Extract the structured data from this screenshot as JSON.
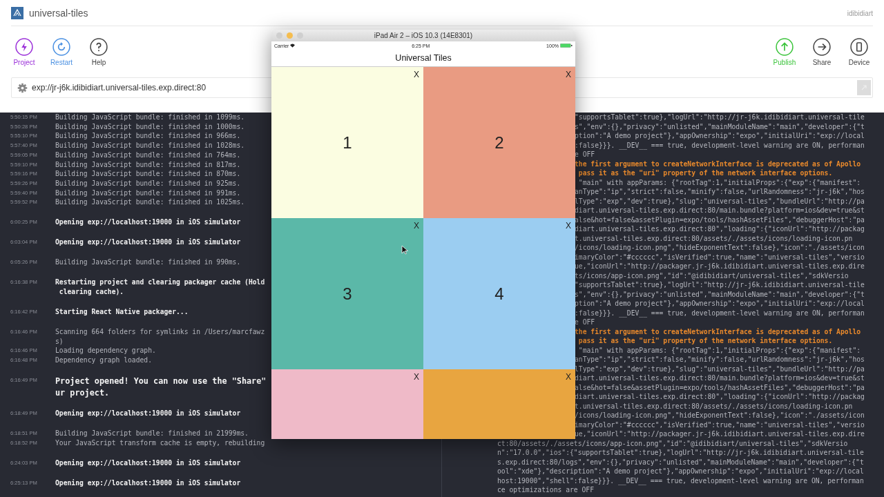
{
  "app": {
    "title": "universal-tiles",
    "user": "idibidiart"
  },
  "toolbar_left": [
    {
      "kind": "project",
      "label": "Project",
      "color": "#9b30d9"
    },
    {
      "kind": "restart",
      "label": "Restart",
      "color": "#4a90e2"
    },
    {
      "kind": "help",
      "label": "Help",
      "color": "#444444"
    }
  ],
  "toolbar_right": [
    {
      "kind": "publish",
      "label": "Publish",
      "color": "#3cc43c"
    },
    {
      "kind": "share",
      "label": "Share",
      "color": "#444444"
    },
    {
      "kind": "device",
      "label": "Device",
      "color": "#444444"
    }
  ],
  "url_field": {
    "value": "exp://jr-j6k.idibidiart.universal-tiles.exp.direct:80"
  },
  "left_log": [
    [
      {
        "time": "5:50:15 PM",
        "kind": "info",
        "lines": [
          "Building JavaScript bundle: finished in 1099ms."
        ]
      },
      {
        "time": "5:50:28 PM",
        "kind": "info",
        "lines": [
          "Building JavaScript bundle: finished in 1000ms."
        ]
      },
      {
        "time": "5:55:10 PM",
        "kind": "info",
        "lines": [
          "Building JavaScript bundle: finished in 966ms."
        ]
      },
      {
        "time": "5:57:40 PM",
        "kind": "info",
        "lines": [
          "Building JavaScript bundle: finished in 1028ms."
        ]
      },
      {
        "time": "5:59:05 PM",
        "kind": "info",
        "lines": [
          "Building JavaScript bundle: finished in 764ms."
        ]
      },
      {
        "time": "5:59:10 PM",
        "kind": "info",
        "lines": [
          "Building JavaScript bundle: finished in 817ms."
        ]
      },
      {
        "time": "5:59:16 PM",
        "kind": "info",
        "lines": [
          "Building JavaScript bundle: finished in 870ms."
        ]
      },
      {
        "time": "5:59:26 PM",
        "kind": "info",
        "lines": [
          "Building JavaScript bundle: finished in 925ms."
        ]
      },
      {
        "time": "5:59:40 PM",
        "kind": "info",
        "lines": [
          "Building JavaScript bundle: finished in 991ms."
        ]
      },
      {
        "time": "5:59:52 PM",
        "kind": "info",
        "lines": [
          "Building JavaScript bundle: finished in 1025ms."
        ]
      }
    ],
    [
      {
        "time": "6:00:25 PM",
        "kind": "event",
        "lines": [
          "Opening exp://localhost:19000 in iOS simulator"
        ]
      }
    ],
    [
      {
        "time": "6:03:04 PM",
        "kind": "event",
        "lines": [
          "Opening exp://localhost:19000 in iOS simulator"
        ]
      }
    ],
    [
      {
        "time": "6:05:26 PM",
        "kind": "info",
        "lines": [
          "Building JavaScript bundle: finished in 990ms."
        ]
      }
    ],
    [
      {
        "time": "6:16:38 PM",
        "kind": "event",
        "lines": [
          "Restarting project and clearing packager cache (Hold",
          " clearing cache)."
        ]
      }
    ],
    [
      {
        "time": "6:16:42 PM",
        "kind": "event",
        "lines": [
          "Starting React Native packager..."
        ]
      }
    ],
    [
      {
        "time": "6:16:46 PM",
        "kind": "info",
        "lines": [
          "Scanning 664 folders for symlinks in /Users/marcfawz",
          "s)"
        ]
      },
      {
        "time": "6:16:46 PM",
        "kind": "info",
        "lines": [
          "Loading dependency graph."
        ]
      },
      {
        "time": "6:16:48 PM",
        "kind": "info",
        "lines": [
          "Dependency graph loaded."
        ]
      }
    ],
    [
      {
        "time": "6:16:49 PM",
        "kind": "notice",
        "lines": [
          "Project opened! You can now use the \"Share\"",
          "ur project."
        ]
      }
    ],
    [
      {
        "time": "6:18:49 PM",
        "kind": "event",
        "lines": [
          "Opening exp://localhost:19000 in iOS simulator"
        ]
      }
    ],
    [
      {
        "time": "6:18:51 PM",
        "kind": "info",
        "lines": [
          "Building JavaScript bundle: finished in 21999ms."
        ]
      },
      {
        "time": "6:18:52 PM",
        "kind": "info",
        "lines": [
          "Your JavaScript transform cache is empty, rebuilding"
        ]
      }
    ],
    [
      {
        "time": "6:24:03 PM",
        "kind": "event",
        "lines": [
          "Opening exp://localhost:19000 in iOS simulator"
        ]
      }
    ],
    [
      {
        "time": "6:25:13 PM",
        "kind": "event",
        "lines": [
          "Opening exp://localhost:19000 in iOS simulator"
        ]
      }
    ]
  ],
  "right_log": {
    "beside_simulator": [
      {
        "text": "\"supportsTablet\":true},\"logUrl\":\"http://jr-j6k.idibidiart.universal-tile",
        "warning": false
      },
      {
        "text": "s\",\"env\":{},\"privacy\":\"unlisted\",\"mainModuleName\":\"main\",\"developer\":{\"t",
        "warning": false
      },
      {
        "text": "ption\":\"A demo project\"},\"appOwnership\":\"expo\",\"initialUri\":\"exp://local",
        "warning": false
      },
      {
        "text": ":false}}}. __DEV__ === true, development-level warning are ON, performan",
        "warning": false
      },
      {
        "text": "e OFF",
        "warning": false
      },
      {
        "text": "the first argument to createNetworkInterface is deprecated as of Apollo",
        "warning": true
      },
      {
        "text": " pass it as the \"uri\" property of the network interface options.",
        "warning": true
      },
      {
        "text": " \"main\" with appParams: {\"rootTag\":1,\"initialProps\":{\"exp\":{\"manifest\":",
        "warning": false
      },
      {
        "text": "anType\":\"ip\",\"strict\":false,\"minify\":false,\"urlRandomness\":\"jr-j6k\",\"hos",
        "warning": false
      },
      {
        "text": "lType\":\"exp\",\"dev\":true},\"slug\":\"universal-tiles\",\"bundleUrl\":\"http://pa",
        "warning": false
      },
      {
        "text": "diart.universal-tiles.exp.direct:80/main.bundle?platform=ios&dev=true&st",
        "warning": false
      },
      {
        "text": "alse&hot=false&assetPlugin=expo/tools/hashAssetFiles\",\"debuggerHost\":\"pa",
        "warning": false
      },
      {
        "text": "diart.universal-tiles.exp.direct:80\",\"loading\":{\"iconUrl\":\"http://packag",
        "warning": false
      },
      {
        "text": "t.universal-tiles.exp.direct:80/assets/./assets/icons/loading-icon.pn",
        "warning": false
      },
      {
        "text": "/icons/loading-icon.png\",\"hideExponentText\":false},\"icon\":\"./assets/icon",
        "warning": false
      },
      {
        "text": "imaryColor\":\"#cccccc\",\"isVerified\":true,\"name\":\"universal-tiles\",\"versio",
        "warning": false
      },
      {
        "text": "ue,\"iconUrl\":\"http://packager.jr-j6k.idibidiart.universal-tiles.exp.dire",
        "warning": false
      },
      {
        "text": "ts/icons/app-icon.png\",\"id\":\"@idibidiart/universal-tiles\",\"sdkVersio",
        "warning": false
      },
      {
        "text": "\"supportsTablet\":true},\"logUrl\":\"http://jr-j6k.idibidiart.universal-tile",
        "warning": false
      },
      {
        "text": "s\",\"env\":{},\"privacy\":\"unlisted\",\"mainModuleName\":\"main\",\"developer\":{\"t",
        "warning": false
      },
      {
        "text": "ption\":\"A demo project\"},\"appOwnership\":\"expo\",\"initialUri\":\"exp://local",
        "warning": false
      },
      {
        "text": ":false}}}. __DEV__ === true, development-level warning are ON, performan",
        "warning": false
      },
      {
        "text": "e OFF",
        "warning": false
      },
      {
        "text": "the first argument to createNetworkInterface is deprecated as of Apollo",
        "warning": true
      },
      {
        "text": " pass it as the \"uri\" property of the network interface options.",
        "warning": true
      },
      {
        "text": " \"main\" with appParams: {\"rootTag\":1,\"initialProps\":{\"exp\":{\"manifest\":",
        "warning": false
      },
      {
        "text": "anType\":\"ip\",\"strict\":false,\"minify\":false,\"urlRandomness\":\"jr-j6k\",\"hos",
        "warning": false
      },
      {
        "text": "lType\":\"exp\",\"dev\":true},\"slug\":\"universal-tiles\",\"bundleUrl\":\"http://pa",
        "warning": false
      },
      {
        "text": "diart.universal-tiles.exp.direct:80/main.bundle?platform=ios&dev=true&st",
        "warning": false
      },
      {
        "text": "alse&hot=false&assetPlugin=expo/tools/hashAssetFiles\",\"debuggerHost\":\"pa",
        "warning": false
      },
      {
        "text": "diart.universal-tiles.exp.direct:80\",\"loading\":{\"iconUrl\":\"http://packag",
        "warning": false
      },
      {
        "text": "t.universal-tiles.exp.direct:80/assets/./assets/icons/loading-icon.pn",
        "warning": false
      },
      {
        "text": "/icons/loading-icon.png\",\"hideExponentText\":false},\"icon\":\"./assets/icon",
        "warning": false
      },
      {
        "text": "imaryColor\":\"#cccccc\",\"isVerified\":true,\"name\":\"universal-tiles\",\"versio",
        "warning": false
      },
      {
        "text": "ue,\"iconUrl\":\"http://packager.jr-j6k.idibidiart.universal-tiles.exp.dire",
        "warning": false
      }
    ],
    "below_simulator": [
      {
        "text": "ct:80/assets/./assets/icons/app-icon.png\",\"id\":\"@idibidiart/universal-tiles\",\"sdkVersio",
        "warning": false
      },
      {
        "text": "n\":\"17.0.0\",\"ios\":{\"supportsTablet\":true},\"logUrl\":\"http://jr-j6k.idibidiart.universal-tile",
        "warning": false
      },
      {
        "text": "s.exp.direct:80/logs\",\"env\":{},\"privacy\":\"unlisted\",\"mainModuleName\":\"main\",\"developer\":{\"t",
        "warning": false
      },
      {
        "text": "ool\":\"xde\"},\"description\":\"A demo project\"},\"appOwnership\":\"expo\",\"initialUri\":\"exp://local",
        "warning": false
      },
      {
        "text": "host:19000\",\"shell\":false}}}. __DEV__ === true, development-level warning are ON, performan",
        "warning": false
      },
      {
        "text": "ce optimizations are OFF",
        "warning": false
      }
    ]
  },
  "simulator": {
    "title": "iPad Air 2 – iOS 10.3 (14E8301)",
    "status_bar": {
      "carrier": "Carrier",
      "time": "6:25 PM",
      "battery": "100%"
    },
    "nav_title": "Universal Tiles",
    "tiles": [
      {
        "label": "1",
        "close": "X",
        "color": "#fbfde1"
      },
      {
        "label": "2",
        "close": "X",
        "color": "#e99b82"
      },
      {
        "label": "3",
        "close": "X",
        "color": "#5bb8a8"
      },
      {
        "label": "4",
        "close": "X",
        "color": "#9bcdf1"
      },
      {
        "close": "X",
        "color": "#efbac8"
      },
      {
        "close": "X",
        "color": "#e8a540"
      }
    ]
  }
}
